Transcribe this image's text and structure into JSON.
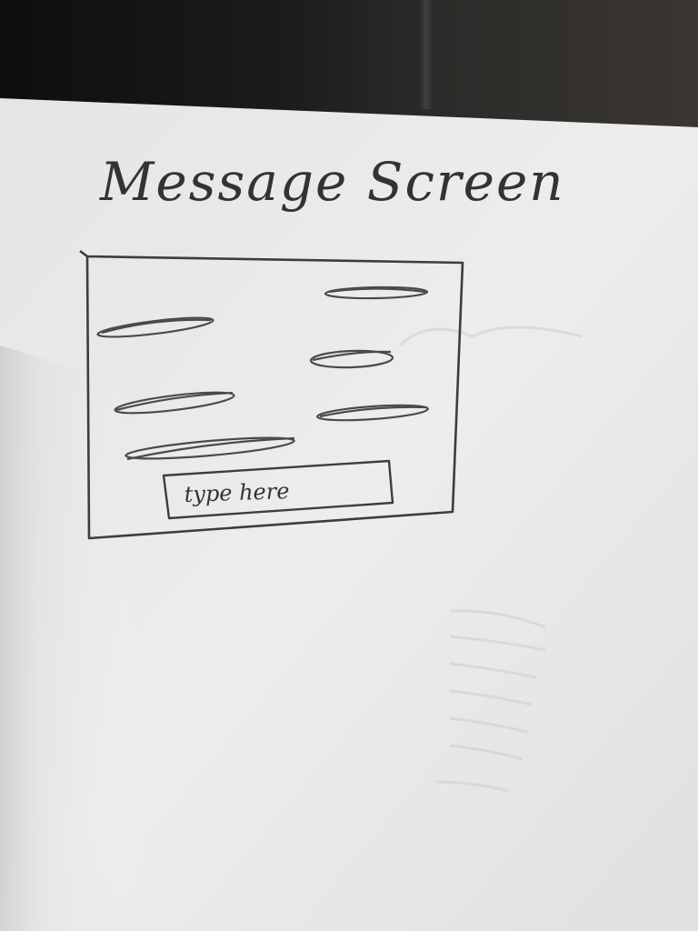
{
  "sketch": {
    "title": "Message Screen",
    "input_placeholder": "type here",
    "received_messages": 3,
    "sent_messages": 3
  },
  "colors": {
    "ink": "#3a3a3a",
    "paper": "#e9eaec",
    "background": "#161616"
  }
}
